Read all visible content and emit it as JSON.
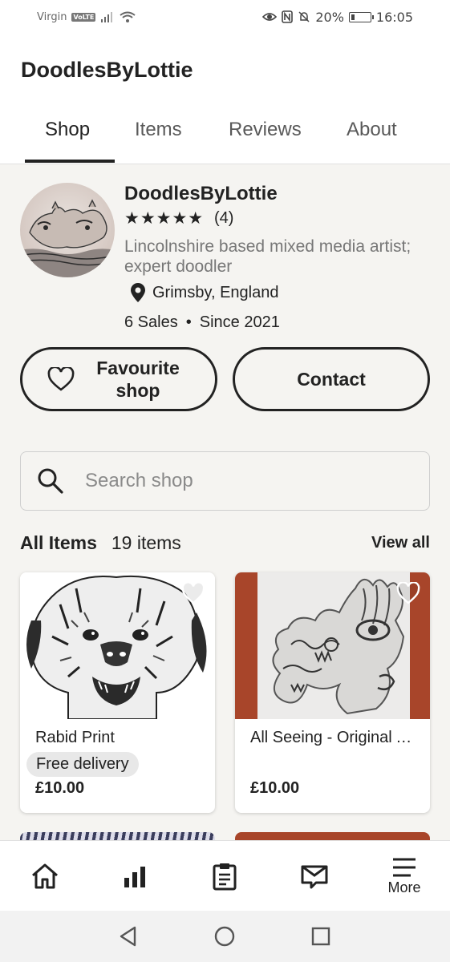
{
  "status_bar": {
    "carrier": "Virgin",
    "network_badge": "VoLTE",
    "battery_percent": "20%",
    "battery_level": 0.2,
    "time": "16:05"
  },
  "header": {
    "title": "DoodlesByLottie",
    "tabs": [
      {
        "label": "Shop",
        "active": true
      },
      {
        "label": "Items",
        "active": false
      },
      {
        "label": "Reviews",
        "active": false
      },
      {
        "label": "About",
        "active": false
      }
    ]
  },
  "profile": {
    "name": "DoodlesByLottie",
    "stars": "★★★★★",
    "rating": 5,
    "rating_count": "(4)",
    "bio": "Lincolnshire based mixed media artist;  expert doodler",
    "location": "Grimsby, England",
    "sales": "6 Sales",
    "since": "Since 2021"
  },
  "actions": {
    "favourite_label": "Favourite shop",
    "contact_label": "Contact"
  },
  "search": {
    "placeholder": "Search shop",
    "value": ""
  },
  "items_section": {
    "title": "All Items",
    "count": "19 items",
    "view_all": "View all"
  },
  "listings": [
    {
      "title": "Rabid Print",
      "badge": "Free delivery",
      "price": "£10.00"
    },
    {
      "title": "All Seeing - Original Artwork",
      "badge": "",
      "price": "£10.00"
    }
  ],
  "bottom_nav": {
    "items": [
      {
        "icon": "home-icon",
        "label": ""
      },
      {
        "icon": "stats-icon",
        "label": ""
      },
      {
        "icon": "orders-icon",
        "label": ""
      },
      {
        "icon": "messages-icon",
        "label": ""
      },
      {
        "icon": "menu-icon",
        "label": "More"
      }
    ]
  },
  "colors": {
    "background": "#f5f4f1",
    "text": "#222222",
    "muted": "#777777",
    "accent_red": "#a8452a"
  }
}
